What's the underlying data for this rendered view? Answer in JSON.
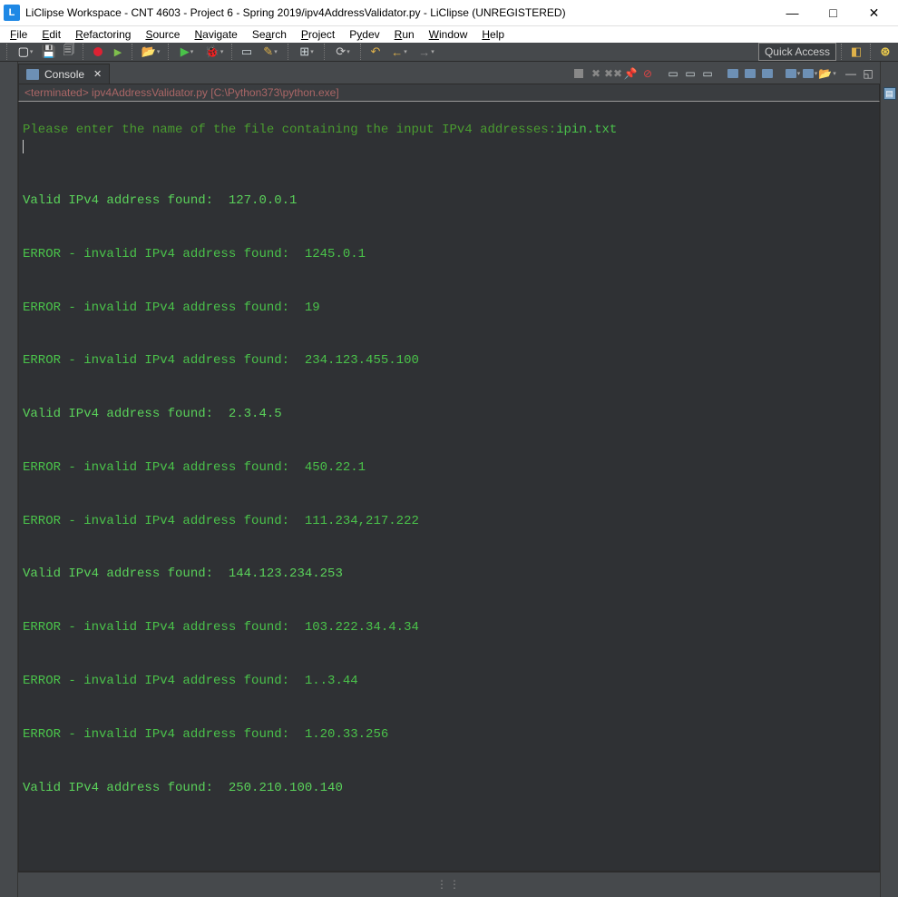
{
  "window": {
    "title": "LiClipse Workspace - CNT 4603 - Project 6 - Spring 2019/ipv4AddressValidator.py - LiClipse (UNREGISTERED)"
  },
  "menu": {
    "items": [
      "File",
      "Edit",
      "Refactoring",
      "Source",
      "Navigate",
      "Search",
      "Project",
      "Pydev",
      "Run",
      "Window",
      "Help"
    ]
  },
  "toolbar": {
    "quick_access": "Quick Access"
  },
  "console": {
    "tab_label": "Console",
    "terminated": "<terminated> ipv4AddressValidator.py [C:\\Python373\\python.exe]",
    "prompt": "Please enter the name of the file containing the input IPv4 addresses:",
    "input_value": "ipin.txt",
    "lines": [
      "Valid IPv4 address found:  127.0.0.1",
      "ERROR - invalid IPv4 address found:  1245.0.1",
      "ERROR - invalid IPv4 address found:  19",
      "ERROR - invalid IPv4 address found:  234.123.455.100",
      "Valid IPv4 address found:  2.3.4.5",
      "ERROR - invalid IPv4 address found:  450.22.1",
      "ERROR - invalid IPv4 address found:  111.234,217.222",
      "Valid IPv4 address found:  144.123.234.253",
      "ERROR - invalid IPv4 address found:  103.222.34.4.34",
      "ERROR - invalid IPv4 address found:  1..3.44",
      "ERROR - invalid IPv4 address found:  1.20.33.256",
      "Valid IPv4 address found:  250.210.100.140"
    ]
  }
}
